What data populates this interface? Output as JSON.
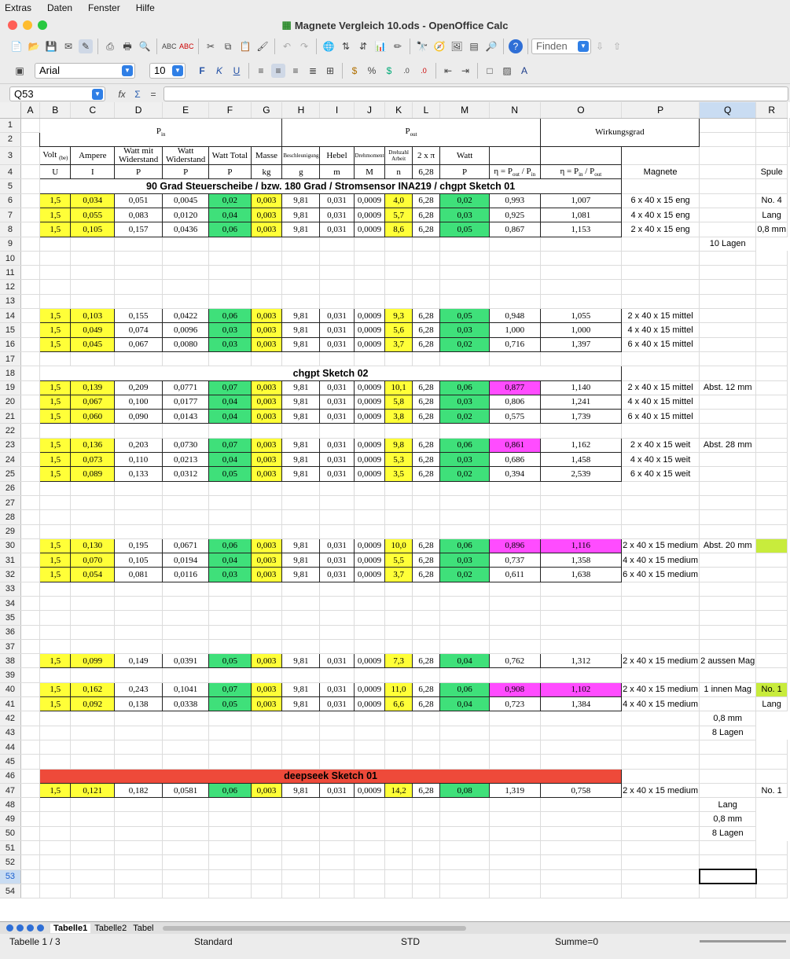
{
  "menu": [
    "Extras",
    "Daten",
    "Fenster",
    "Hilfe"
  ],
  "window_title": "Magnete Vergleich 10.ods - OpenOffice Calc",
  "toolbar": {
    "find_placeholder": "Finden",
    "font_name": "Arial",
    "font_size": "10"
  },
  "formula_bar": {
    "name_box": "Q53",
    "content": ""
  },
  "columns": [
    "A",
    "B",
    "C",
    "D",
    "E",
    "F",
    "G",
    "H",
    "I",
    "J",
    "K",
    "L",
    "M",
    "N",
    "O",
    "P",
    "Q",
    "R"
  ],
  "header": {
    "p_in": "P",
    "p_in_sub": "in",
    "p_out": "P",
    "p_out_sub": "out",
    "wirkungsgrad": "Wirkungsgrad",
    "h3": [
      "Volt",
      "Ampere",
      "Watt mit Widerstand",
      "Watt Widerstand",
      "Watt Total",
      "Masse",
      "Beschleunigung",
      "Hebel",
      "Drehmoment",
      "Drehzahl Arbeit",
      "2 x π",
      "Watt"
    ],
    "volt_sub": "(be)",
    "h4": [
      "U",
      "I",
      "P",
      "P",
      "P",
      "kg",
      "g",
      "m",
      "M",
      "n",
      "6,28",
      "P"
    ],
    "eta1": "η = P",
    "eta2": "η = P",
    "magnete": "Magnete",
    "spule": "Spule"
  },
  "rows": [
    {
      "r": 5,
      "title": "90 Grad Steuerscheibe / bzw. 180 Grad / Stromsensor INA219 / chgpt Sketch 01"
    },
    {
      "r": 6,
      "v": [
        "1,5",
        "0,034",
        "0,051",
        "0,0045",
        "0,02",
        "0,003",
        "9,81",
        "0,031",
        "0,0009",
        "4,0",
        "6,28",
        "0,02",
        "0,993",
        "1,007"
      ],
      "p": "6 x 40 x 15 eng",
      "r_col": "No. 4"
    },
    {
      "r": 7,
      "v": [
        "1,5",
        "0,055",
        "0,083",
        "0,0120",
        "0,04",
        "0,003",
        "9,81",
        "0,031",
        "0,0009",
        "5,7",
        "6,28",
        "0,03",
        "0,925",
        "1,081"
      ],
      "p": "4 x 40 x 15 eng",
      "r_col": "Lang"
    },
    {
      "r": 8,
      "v": [
        "1,5",
        "0,105",
        "0,157",
        "0,0436",
        "0,06",
        "0,003",
        "9,81",
        "0,031",
        "0,0009",
        "8,6",
        "6,28",
        "0,05",
        "0,867",
        "1,153"
      ],
      "p": "2 x 40 x 15 eng",
      "r_col": "0,8 mm"
    },
    {
      "r": 9,
      "r_col": "10 Lagen"
    },
    {
      "r": 14,
      "v": [
        "1,5",
        "0,103",
        "0,155",
        "0,0422",
        "0,06",
        "0,003",
        "9,81",
        "0,031",
        "0,0009",
        "9,3",
        "6,28",
        "0,05",
        "0,948",
        "1,055"
      ],
      "p": "2 x 40 x 15 mittel"
    },
    {
      "r": 15,
      "v": [
        "1,5",
        "0,049",
        "0,074",
        "0,0096",
        "0,03",
        "0,003",
        "9,81",
        "0,031",
        "0,0009",
        "5,6",
        "6,28",
        "0,03",
        "1,000",
        "1,000"
      ],
      "p": "4 x 40 x 15 mittel"
    },
    {
      "r": 16,
      "v": [
        "1,5",
        "0,045",
        "0,067",
        "0,0080",
        "0,03",
        "0,003",
        "9,81",
        "0,031",
        "0,0009",
        "3,7",
        "6,28",
        "0,02",
        "0,716",
        "1,397"
      ],
      "p": "6 x 40 x 15 mittel"
    },
    {
      "r": 18,
      "title": "chgpt Sketch 02"
    },
    {
      "r": 19,
      "v": [
        "1,5",
        "0,139",
        "0,209",
        "0,0771",
        "0,07",
        "0,003",
        "9,81",
        "0,031",
        "0,0009",
        "10,1",
        "6,28",
        "0,06",
        "0,877",
        "1,140"
      ],
      "p": "2 x 40 x 15 mittel",
      "q": "Abst. 12 mm",
      "mN": true
    },
    {
      "r": 20,
      "v": [
        "1,5",
        "0,067",
        "0,100",
        "0,0177",
        "0,04",
        "0,003",
        "9,81",
        "0,031",
        "0,0009",
        "5,8",
        "6,28",
        "0,03",
        "0,806",
        "1,241"
      ],
      "p": "4 x 40 x 15 mittel"
    },
    {
      "r": 21,
      "v": [
        "1,5",
        "0,060",
        "0,090",
        "0,0143",
        "0,04",
        "0,003",
        "9,81",
        "0,031",
        "0,0009",
        "3,8",
        "6,28",
        "0,02",
        "0,575",
        "1,739"
      ],
      "p": "6 x 40 x 15 mittel"
    },
    {
      "r": 23,
      "v": [
        "1,5",
        "0,136",
        "0,203",
        "0,0730",
        "0,07",
        "0,003",
        "9,81",
        "0,031",
        "0,0009",
        "9,8",
        "6,28",
        "0,06",
        "0,861",
        "1,162"
      ],
      "p": "2 x 40 x 15 weit",
      "q": "Abst. 28 mm",
      "mN": true
    },
    {
      "r": 24,
      "v": [
        "1,5",
        "0,073",
        "0,110",
        "0,0213",
        "0,04",
        "0,003",
        "9,81",
        "0,031",
        "0,0009",
        "5,3",
        "6,28",
        "0,03",
        "0,686",
        "1,458"
      ],
      "p": "4 x 40 x 15 weit"
    },
    {
      "r": 25,
      "v": [
        "1,5",
        "0,089",
        "0,133",
        "0,0312",
        "0,05",
        "0,003",
        "9,81",
        "0,031",
        "0,0009",
        "3,5",
        "6,28",
        "0,02",
        "0,394",
        "2,539"
      ],
      "p": "6 x 40 x 15 weit"
    },
    {
      "r": 30,
      "v": [
        "1,5",
        "0,130",
        "0,195",
        "0,0671",
        "0,06",
        "0,003",
        "9,81",
        "0,031",
        "0,0009",
        "10,0",
        "6,28",
        "0,06",
        "0,896",
        "1,116"
      ],
      "p": "2 x 40 x 15 medium",
      "q": "Abst. 20 mm",
      "mN": true,
      "mO": true,
      "rg": true
    },
    {
      "r": 31,
      "v": [
        "1,5",
        "0,070",
        "0,105",
        "0,0194",
        "0,04",
        "0,003",
        "9,81",
        "0,031",
        "0,0009",
        "5,5",
        "6,28",
        "0,03",
        "0,737",
        "1,358"
      ],
      "p": "4 x 40 x 15 medium"
    },
    {
      "r": 32,
      "v": [
        "1,5",
        "0,054",
        "0,081",
        "0,0116",
        "0,03",
        "0,003",
        "9,81",
        "0,031",
        "0,0009",
        "3,7",
        "6,28",
        "0,02",
        "0,611",
        "1,638"
      ],
      "p": "6 x 40 x 15 medium"
    },
    {
      "r": 38,
      "v": [
        "1,5",
        "0,099",
        "0,149",
        "0,0391",
        "0,05",
        "0,003",
        "9,81",
        "0,031",
        "0,0009",
        "7,3",
        "6,28",
        "0,04",
        "0,762",
        "1,312"
      ],
      "p": "2 x 40 x 15 medium",
      "q": "2 aussen Mag"
    },
    {
      "r": 40,
      "v": [
        "1,5",
        "0,162",
        "0,243",
        "0,1041",
        "0,07",
        "0,003",
        "9,81",
        "0,031",
        "0,0009",
        "11,0",
        "6,28",
        "0,06",
        "0,908",
        "1,102"
      ],
      "p": "2 x 40 x 15 medium",
      "q": "1 innen Mag",
      "mN": true,
      "mO": true,
      "r_col": "No. 1",
      "rg": true
    },
    {
      "r": 41,
      "v": [
        "1,5",
        "0,092",
        "0,138",
        "0,0338",
        "0,05",
        "0,003",
        "9,81",
        "0,031",
        "0,0009",
        "6,6",
        "6,28",
        "0,04",
        "0,723",
        "1,384"
      ],
      "p": "4 x 40 x 15 medium",
      "r_col": "Lang"
    },
    {
      "r": 42,
      "r_col": "0,8 mm"
    },
    {
      "r": 43,
      "r_col": "8 Lagen"
    },
    {
      "r": 46,
      "title": "deepseek Sketch 01",
      "red": true
    },
    {
      "r": 47,
      "v": [
        "1,5",
        "0,121",
        "0,182",
        "0,0581",
        "0,06",
        "0,003",
        "9,81",
        "0,031",
        "0,0009",
        "14,2",
        "6,28",
        "0,08",
        "1,319",
        "0,758"
      ],
      "p": "2 x 40 x 15  medium",
      "r_col": "No. 1"
    },
    {
      "r": 48,
      "r_col": "Lang"
    },
    {
      "r": 49,
      "r_col": "0,8 mm"
    },
    {
      "r": 50,
      "r_col": "8 Lagen"
    }
  ],
  "sheet_tabs": [
    "Tabelle1",
    "Tabelle2",
    "Tabel"
  ],
  "status": {
    "sheet": "Tabelle 1 / 3",
    "style": "Standard",
    "mode": "STD",
    "sum": "Summe=0"
  }
}
